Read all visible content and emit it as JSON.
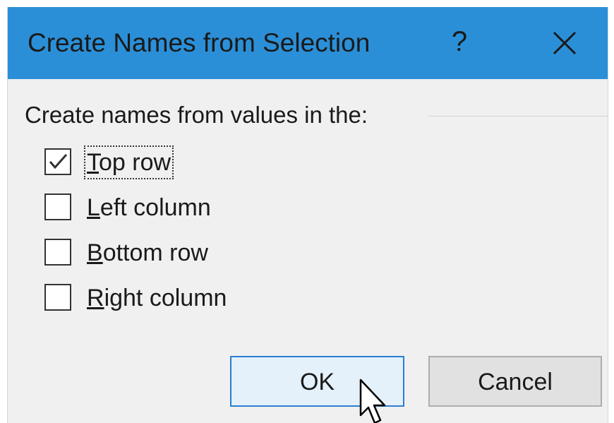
{
  "dialog": {
    "title": "Create Names from Selection",
    "help_label": "?",
    "close_icon": "close-icon"
  },
  "group": {
    "label": "Create names from values in the:"
  },
  "options": [
    {
      "accel": "T",
      "rest": "op row",
      "checked": true,
      "focused": true
    },
    {
      "accel": "L",
      "rest": "eft column",
      "checked": false,
      "focused": false
    },
    {
      "accel": "B",
      "rest": "ottom row",
      "checked": false,
      "focused": false
    },
    {
      "accel": "R",
      "rest": "ight column",
      "checked": false,
      "focused": false
    }
  ],
  "buttons": {
    "ok_label": "OK",
    "cancel_label": "Cancel"
  },
  "colors": {
    "titlebar": "#2b8fd8",
    "dialog_bg": "#f0f0f0",
    "ok_border": "#2a7fd0"
  }
}
